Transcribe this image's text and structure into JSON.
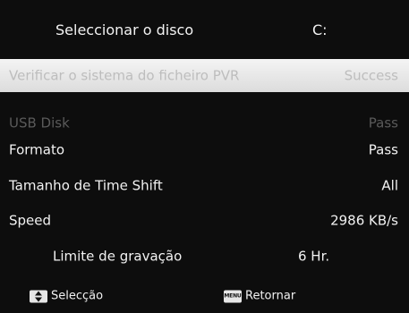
{
  "header": {
    "label": "Seleccionar o disco",
    "value": "C:"
  },
  "rows": [
    {
      "label": "Verificar o sistema do ficheiro PVR",
      "value": "Success"
    },
    {
      "label": "USB Disk",
      "value": "Pass"
    },
    {
      "label": "Formato",
      "value": "Pass"
    },
    {
      "label": "Tamanho de Time Shift",
      "value": "All"
    },
    {
      "label": "Speed",
      "value": "2986 KB/s"
    },
    {
      "label": "Limite de gravação",
      "value": "6 Hr."
    }
  ],
  "footer": {
    "select_icon": "up-down-arrows-icon",
    "select_label": "Selecção",
    "menu_icon": "menu-key-icon",
    "menu_icon_text": "MENU",
    "return_label": "Retornar"
  }
}
